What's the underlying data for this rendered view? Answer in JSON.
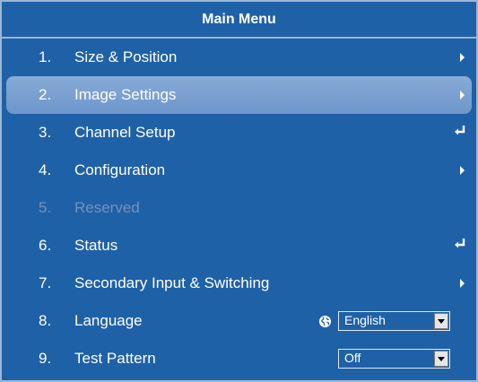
{
  "menu": {
    "title": "Main Menu",
    "items": [
      {
        "num": "1.",
        "label": "Size & Position",
        "action": "submenu-arrow-icon"
      },
      {
        "num": "2.",
        "label": "Image Settings",
        "action": "submenu-arrow-icon",
        "selected": true
      },
      {
        "num": "3.",
        "label": "Channel Setup",
        "action": "enter-icon"
      },
      {
        "num": "4.",
        "label": "Configuration",
        "action": "submenu-arrow-icon"
      },
      {
        "num": "5.",
        "label": "Reserved",
        "disabled": true
      },
      {
        "num": "6.",
        "label": "Status",
        "action": "enter-icon"
      },
      {
        "num": "7.",
        "label": "Secondary Input & Switching",
        "action": "submenu-arrow-icon"
      },
      {
        "num": "8.",
        "label": "Language",
        "control": {
          "icon": "globe-icon",
          "value": "English"
        }
      },
      {
        "num": "9.",
        "label": "Test Pattern",
        "control": {
          "value": "Off"
        }
      }
    ]
  },
  "colors": {
    "background": "#1f61a7",
    "border": "#9bb7d7",
    "selected": "#7aa1d1",
    "text": "#ffffff",
    "disabled_text": "#6f93be"
  }
}
